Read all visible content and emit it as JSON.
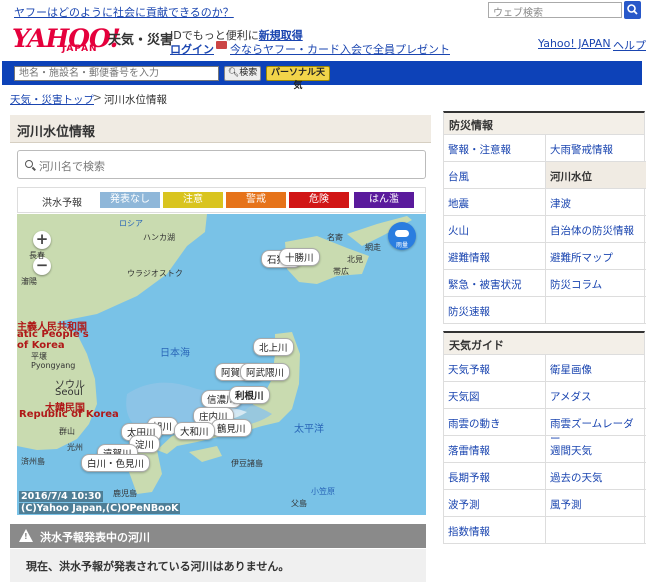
{
  "promo": "ヤフーはどのように社会に貢献できるのか？",
  "top_search_placeholder": "ウェブ検索",
  "header": {
    "logo": "YAHOO!",
    "logo_sub": "JAPAN",
    "service": "天気・災害",
    "id_text_prefix": "IDでもっと便利に",
    "new_account": "新規取得",
    "login": "ログイン",
    "card_promo": "今ならヤフー・カード入会で全員プレゼント",
    "yahoo_japan": "Yahoo! JAPAN",
    "help": "ヘルプ"
  },
  "searchbar": {
    "placeholder": "地名・施設名・郵便番号を入力",
    "search_button": "検索",
    "personal_button": "パーソナル天気"
  },
  "breadcrumb": {
    "home": "天気・災害トップ",
    "sep": ">",
    "current": "河川水位情報"
  },
  "main": {
    "title": "河川水位情報",
    "river_search_placeholder": "河川名で検索",
    "legend_title": "洪水予報",
    "legend": [
      {
        "label": "発表なし",
        "color": "#8fb7d9"
      },
      {
        "label": "注意",
        "color": "#d9c41f"
      },
      {
        "label": "警戒",
        "color": "#e6731a"
      },
      {
        "label": "危険",
        "color": "#d11515"
      },
      {
        "label": "はん濫",
        "color": "#5a1a9c"
      }
    ]
  },
  "map": {
    "zoom_in": "+",
    "zoom_out": "−",
    "rain_label": "雨量",
    "timestamp": "2016/7/4 10:30",
    "copyright": "(C)Yahoo Japan,(C)OPeNBooK",
    "labels": {
      "l1": "ロシア",
      "l2": "ハンカ湖",
      "l3": "ウラジオストク",
      "l4": "長春",
      "l5": "瀋陽",
      "l6": "主義人民共和国",
      "l7": "atic People's",
      "l8": "of Korea",
      "l9": "平壌",
      "l10": "Pyongyang",
      "l11": "ソウル",
      "l12": "Seoul",
      "l13": "大韓民国",
      "l14": "Republic of Korea",
      "l15": "日本海",
      "l16": "太平洋",
      "l17": "群山",
      "l18": "光州",
      "l19": "済州島",
      "l20": "鹿児島",
      "l21": "伊豆諸島",
      "l22": "名寄",
      "l23": "北見",
      "l24": "帯広",
      "l25": "網走",
      "l26": "父島",
      "l27": "小笠原"
    },
    "rivers": {
      "tokachi": "十勝川",
      "ishikari": "石狩川",
      "kitakami": "北上川",
      "aga": "阿賀野川",
      "abukuma": "阿武隈川",
      "tone": "利根川",
      "shinano": "信濃川",
      "shonai": "庄内川",
      "yodo": "淀川",
      "asahi": "旭川",
      "ota": "太田川",
      "onga": "遠賀川",
      "tsurumi": "鶴見川",
      "chikugo": "筑後川",
      "yamato": "大和川",
      "shirakawa": "白川・色見川"
    }
  },
  "warning": {
    "title": "洪水予報発表中の河川",
    "message": "現在、洪水予報が発表されている河川はありません。"
  },
  "sidebar": {
    "disaster_title": "防災情報",
    "disaster_items": [
      "警報・注意報",
      "大雨警戒情報",
      "台風",
      "河川水位",
      "地震",
      "津波",
      "火山",
      "自治体の防災情報",
      "避難情報",
      "避難所マップ",
      "緊急・被害状況",
      "防災コラム",
      "防災速報",
      ""
    ],
    "weather_title": "天気ガイド",
    "weather_items": [
      "天気予報",
      "衛星画像",
      "天気図",
      "アメダス",
      "雨雲の動き",
      "雨雲ズームレーダー",
      "落雷情報",
      "週間天気",
      "長期予報",
      "過去の天気",
      "波予測",
      "風予測",
      "指数情報",
      ""
    ]
  }
}
